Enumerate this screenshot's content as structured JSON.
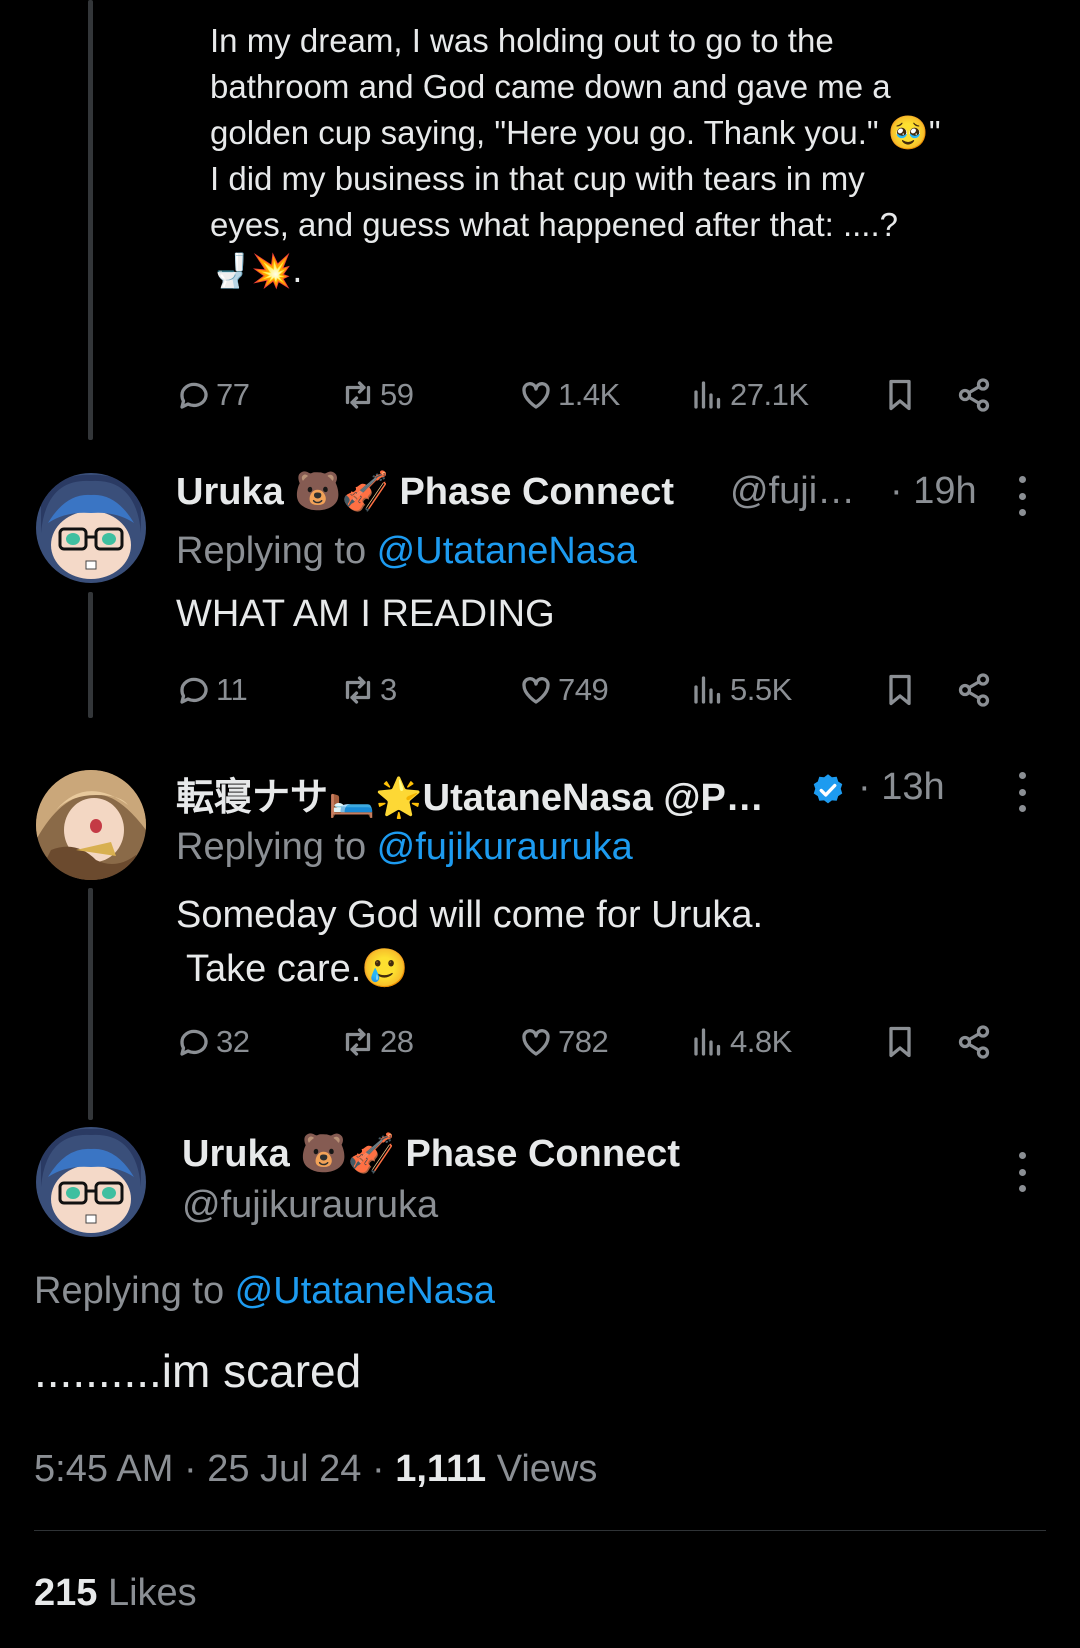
{
  "quoted_tweet": {
    "lines": [
      "In my dream, I was holding out to go to the",
      "bathroom and God came down and gave me a",
      "golden cup saying, \"Here you go. Thank you.\" 🥹\"",
      "I did my business in that cup with tears in my",
      "eyes, and guess what happened after that: ....?",
      "🚽💥."
    ],
    "stats": {
      "replies": "77",
      "reposts": "59",
      "likes": "1.4K",
      "views": "27.1K"
    }
  },
  "reply1": {
    "name": "Uruka 🐻🎻 Phase Connect",
    "handle": "@fuji…",
    "time": "· 19h",
    "replying_prefix": "Replying to ",
    "replying_to": "@UtataneNasa",
    "text": "WHAT AM I READING",
    "stats": {
      "replies": "11",
      "reposts": "3",
      "likes": "749",
      "views": "5.5K"
    }
  },
  "reply2": {
    "name": "転寝ナサ🛏️🌟UtataneNasa @P…",
    "time": "· 13h",
    "replying_prefix": "Replying to ",
    "replying_to": "@fujikurauruka",
    "text_line1": "Someday God will come for Uruka.",
    "text_line2": "Take care.🥲",
    "stats": {
      "replies": "32",
      "reposts": "28",
      "likes": "782",
      "views": "4.8K"
    }
  },
  "main_tweet": {
    "name": "Uruka 🐻🎻 Phase Connect",
    "handle": "@fujikurauruka",
    "replying_prefix": "Replying to ",
    "replying_to": "@UtataneNasa",
    "text": "..........im scared",
    "time": "5:45 AM",
    "date": "25 Jul 24",
    "views_count": "1,111",
    "views_label": "Views",
    "likes_count": "215",
    "likes_label": "Likes"
  },
  "colors": {
    "background": "#000000",
    "text": "#e7e9ea",
    "muted": "#8b8f94",
    "link": "#1d9bf0",
    "verified": "#1d9bf0"
  },
  "icons": [
    "reply-icon",
    "repost-icon",
    "like-icon",
    "views-icon",
    "bookmark-icon",
    "share-icon",
    "more-icon",
    "verified-badge-icon"
  ]
}
